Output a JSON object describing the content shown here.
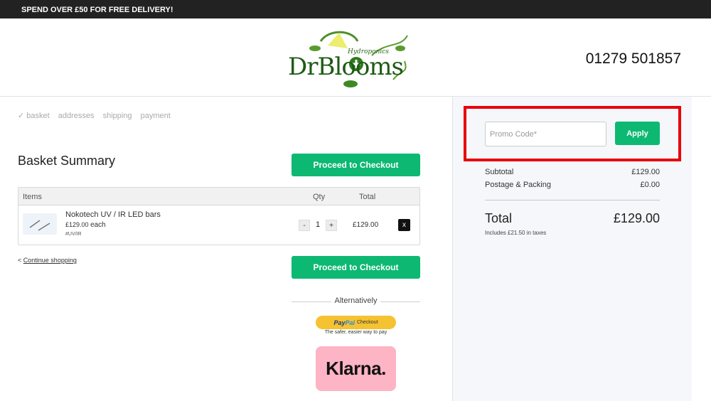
{
  "topbar": {
    "text": "SPEND OVER £50 FOR FREE DELIVERY!"
  },
  "header": {
    "logo_main": "DrBlooms",
    "logo_sub": "Hydroponics",
    "phone": "01279 501857"
  },
  "steps": [
    "✓ basket",
    "addresses",
    "shipping",
    "payment"
  ],
  "basket": {
    "title": "Basket Summary",
    "checkout_label": "Proceed to Checkout",
    "columns": {
      "items": "Items",
      "qty": "Qty",
      "total": "Total"
    },
    "item": {
      "name": "Nokotech UV / IR LED bars",
      "price": "£129.00",
      "each": "each",
      "sku": "#UV/IR",
      "qty": "1",
      "minus": "-",
      "plus": "+",
      "total": "£129.00",
      "remove": "x"
    },
    "continue_prefix": "<",
    "continue_label": "Continue shopping",
    "alternatively": "Alternatively"
  },
  "paypal": {
    "brand_a": "Pay",
    "brand_b": "Pal",
    "cta": "Checkout",
    "tagline": "The safer, easier way to pay"
  },
  "klarna": {
    "label": "Klarna."
  },
  "summary": {
    "promo_placeholder": "Promo Code*",
    "apply_label": "Apply",
    "subtotal_label": "Subtotal",
    "subtotal_value": "£129.00",
    "postage_label": "Postage & Packing",
    "postage_value": "£0.00",
    "total_label": "Total",
    "total_value": "£129.00",
    "taxes_note": "Includes £21.50 in taxes"
  },
  "colors": {
    "accent": "#0db873",
    "highlight": "#e8000c",
    "topbar": "#222222",
    "klarna": "#fdb4c5",
    "paypal": "#f5c231"
  }
}
